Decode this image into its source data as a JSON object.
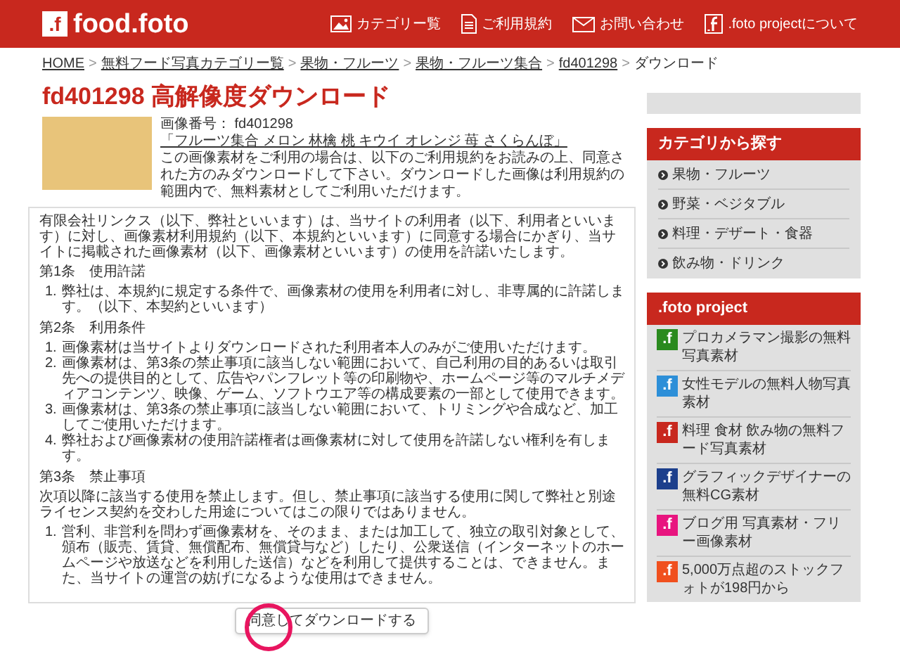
{
  "header": {
    "logo_mark": ".f",
    "logo_text": "food.foto",
    "nav": [
      {
        "label": "カテゴリー覧"
      },
      {
        "label": "ご利用規約"
      },
      {
        "label": "お問い合わせ"
      },
      {
        "label": ".foto projectについて"
      }
    ]
  },
  "breadcrumb_separator": ">",
  "breadcrumb": [
    {
      "label": "HOME",
      "link": true
    },
    {
      "label": "無料フード写真カテゴリー覧",
      "link": true
    },
    {
      "label": "果物・フルーツ",
      "link": true
    },
    {
      "label": "果物・フルーツ集合",
      "link": true
    },
    {
      "label": "fd401298",
      "link": true
    },
    {
      "label": "ダウンロード",
      "link": false
    }
  ],
  "title": "fd401298 高解像度ダウンロード",
  "image_info": {
    "number": "画像番号： fd401298",
    "caption": "「フルーツ集合 メロン 林檎 桃 キウイ オレンジ 苺 さくらんぼ」",
    "description": "この画像素材をご利用の場合は、以下のご利用規約をお読みの上、同意された方のみダウンロードして下さい。ダウンロードした画像は利用規約の範囲内で、無料素材としてご利用いただけます。"
  },
  "terms": [
    {
      "kind": "paragraph",
      "text": "有限会社リンクス（以下、弊社といいます）は、当サイトの利用者（以下、利用者といいます）に対し、画像素材利用規約（以下、本規約といいます）に同意する場合にかぎり、当サイトに掲載された画像素材（以下、画像素材といいます）の使用を許諾いたします。"
    },
    {
      "kind": "heading",
      "text": "第1条　使用許諾"
    },
    {
      "kind": "list",
      "items": [
        {
          "number": "1.",
          "text": "弊社は、本規約に規定する条件で、画像素材の使用を利用者に対し、非専属的に許諾します。（以下、本契約といいます）"
        }
      ]
    },
    {
      "kind": "heading",
      "text": "第2条　利用条件"
    },
    {
      "kind": "list",
      "items": [
        {
          "number": "1.",
          "text": "画像素材は当サイトよりダウンロードされた利用者本人のみがご使用いただけます。"
        },
        {
          "number": "2.",
          "text": "画像素材は、第3条の禁止事項に該当しない範囲において、自己利用の目的あるいは取引先への提供目的として、広告やパンフレット等の印刷物や、ホームページ等のマルチメディアコンテンツ、映像、ゲーム、ソフトウエア等の構成要素の一部として使用できます。"
        },
        {
          "number": "3.",
          "text": "画像素材は、第3条の禁止事項に該当しない範囲において、トリミングや合成など、加工してご使用いただけます。"
        },
        {
          "number": "4.",
          "text": "弊社および画像素材の使用許諾権者は画像素材に対して使用を許諾しない権利を有します。"
        }
      ]
    },
    {
      "kind": "heading",
      "text": "第3条　禁止事項"
    },
    {
      "kind": "paragraph",
      "text": "次項以降に該当する使用を禁止します。但し、禁止事項に該当する使用に関して弊社と別途ライセンス契約を交わした用途についてはこの限りではありません。"
    },
    {
      "kind": "list",
      "items": [
        {
          "number": "1.",
          "text": "営利、非営利を問わず画像素材を、そのまま、または加工して、独立の取引対象として、頒布（販売、賃貸、無償配布、無償貸与など）したり、公衆送信（インターネットのホームページや放送などを利用した送信）などを利用して提供することは、できません。また、当サイトの運営の妨げになるような使用はできません。"
        }
      ]
    }
  ],
  "agree_button": "同意してダウンロードする",
  "sidebar": {
    "category_title": "カテゴリから探す",
    "categories": [
      "果物・フルーツ",
      "野菜・ベジタブル",
      "料理・デザート・食器",
      "飲み物・ドリンク"
    ],
    "project_title": ".foto project",
    "projects": [
      {
        "mark": ".f",
        "color": "#2a8a1e",
        "label": "プロカメラマン撮影の無料写真素材"
      },
      {
        "mark": ".f",
        "color": "#2d8fd8",
        "label": "女性モデルの無料人物写真素材"
      },
      {
        "mark": ".f",
        "color": "#c8281e",
        "label": "料理 食材 飲み物の無料フード写真素材"
      },
      {
        "mark": ".f",
        "color": "#1c3f8c",
        "label": "グラフィックデザイナーの無料CG素材"
      },
      {
        "mark": ".f",
        "color": "#e8157f",
        "label": "ブログ用 写真素材・フリー画像素材"
      },
      {
        "mark": ".f",
        "color": "#f0501e",
        "label": "5,000万点超のストックフォトが198円から"
      }
    ]
  }
}
